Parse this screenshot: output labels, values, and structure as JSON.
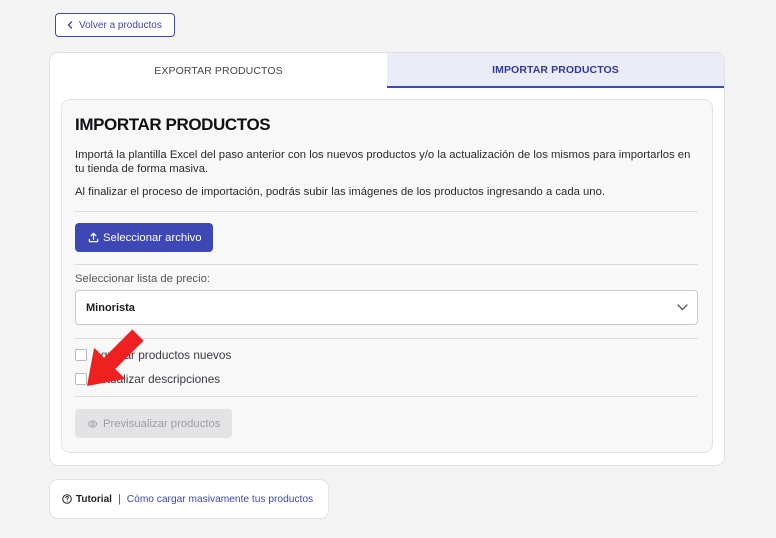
{
  "colors": {
    "accent": "#3e47b6",
    "accent_text": "#2f3a9e",
    "active_tab_bg": "#e9ebf7",
    "page_bg": "#f3f3f4",
    "annotation": "#ef2020"
  },
  "back_button": {
    "icon": "chevron-left-icon",
    "label": "Volver a productos"
  },
  "tabs": [
    {
      "label": "EXPORTAR PRODUCTOS",
      "active": false
    },
    {
      "label": "IMPORTAR PRODUCTOS",
      "active": true
    }
  ],
  "import_panel": {
    "title": "IMPORTAR PRODUCTOS",
    "description": "Importá la plantilla Excel del paso anterior con los nuevos productos y/o la actualización de los mismos para importarlos en tu tienda de forma masiva.",
    "note": "Al finalizar el proceso de importación, podrás subir las imágenes de los productos ingresando a cada uno.",
    "select_file_button": {
      "icon": "upload-icon",
      "label": "Seleccionar archivo"
    },
    "price_list": {
      "label": "Seleccionar lista de precio:",
      "selected": "Minorista",
      "icon": "chevron-down-icon"
    },
    "options": [
      {
        "label": "Agregar productos nuevos",
        "checked": false
      },
      {
        "label": "Actualizar descripciones",
        "checked": false
      }
    ],
    "preview_button": {
      "icon": "eye-icon",
      "label": "Previsualizar productos",
      "disabled": true
    }
  },
  "tutorial": {
    "icon": "help-circle-icon",
    "label": "Tutorial",
    "separator": "|",
    "link": "Cómo cargar masivamente tus productos"
  },
  "annotation": {
    "icon": "red-arrow-icon"
  }
}
